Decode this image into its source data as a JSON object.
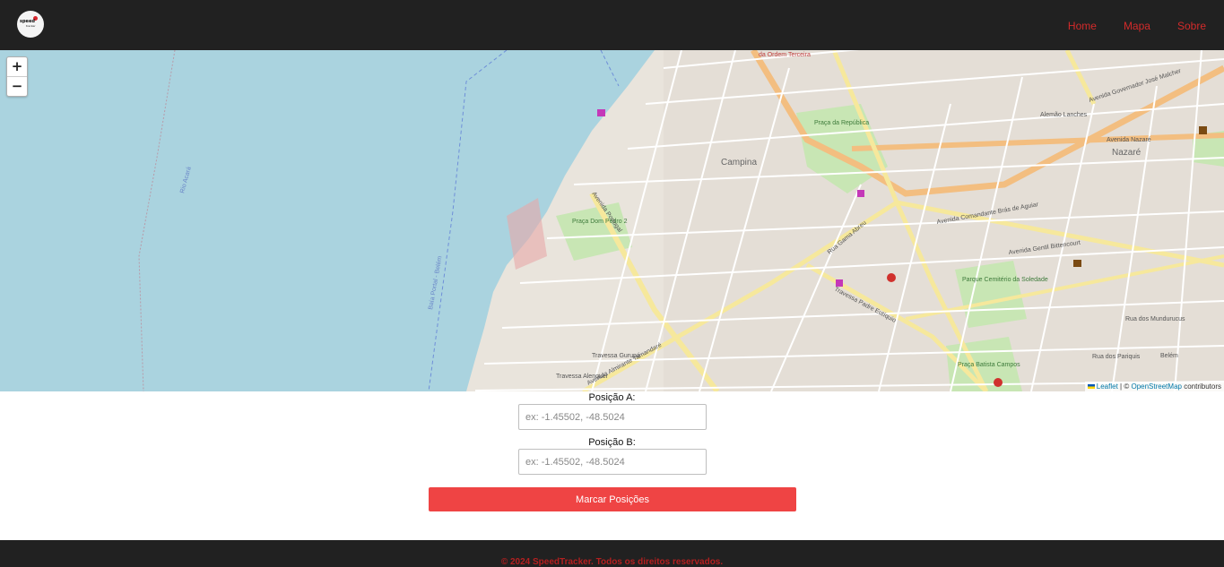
{
  "header": {
    "logo_text": "speed",
    "logo_sub": "tracker",
    "nav": [
      {
        "label": "Home"
      },
      {
        "label": "Mapa"
      },
      {
        "label": "Sobre"
      }
    ]
  },
  "map": {
    "zoom_in": "+",
    "zoom_out": "−",
    "attribution_leaflet": "Leaflet",
    "attribution_sep": "| ©",
    "attribution_osm": "OpenStreetMap",
    "attribution_tail": "contributors",
    "labels": {
      "campina": "Campina",
      "nazare": "Nazaré",
      "praca_republica": "Praça da República",
      "praca_dom_pedro": "Praça Dom Pedro 2",
      "parque_soledade": "Parque Cemitério da Soledade",
      "praca_batista": "Praça Batista Campos",
      "ordem_terceira": "da Ordem Terceira",
      "baia_guajara": "Baía Portal - Belém",
      "rio_acara": "Rio Acará",
      "av_nazare": "Avenida Nazaré",
      "av_gov_jose_malcher": "Avenida Governador José Malcher",
      "av_gentil": "Avenida Gentil Bittencourt",
      "av_bras_aguiar": "Avenida Comandante Brás de Aguiar",
      "av_almirante": "Avenida Almirante Tamandaré",
      "av_portugal": "Avenida Portugal",
      "tv_gurupa": "Travessa Gurupá",
      "tv_alenquer": "Travessa Alenquer",
      "rua_mundurucus": "Rua dos Mundurucus",
      "rua_pariquis": "Rua dos Pariquis",
      "rua_gama_abreu": "Rua Gama Abreu",
      "tv_padre_eutiquio": "Travessa Padre Eutíquio",
      "alemao_lanches": "Alemão Lanches",
      "belem": "Belém"
    }
  },
  "form": {
    "pos_a_label": "Posição A:",
    "pos_a_placeholder": "ex: -1.45502, -48.5024",
    "pos_b_label": "Posição B:",
    "pos_b_placeholder": "ex: -1.45502, -48.5024",
    "submit_label": "Marcar Posições"
  },
  "footer": {
    "text": "© 2024 SpeedTracker. Todos os direitos reservados."
  },
  "colors": {
    "topbar": "#212121",
    "nav": "#d32b2b",
    "button": "#ef4444",
    "water": "#aad3df",
    "land": "#e9e4dc",
    "major_road": "#fcd6a4",
    "secondary_road": "#f7fabf"
  }
}
